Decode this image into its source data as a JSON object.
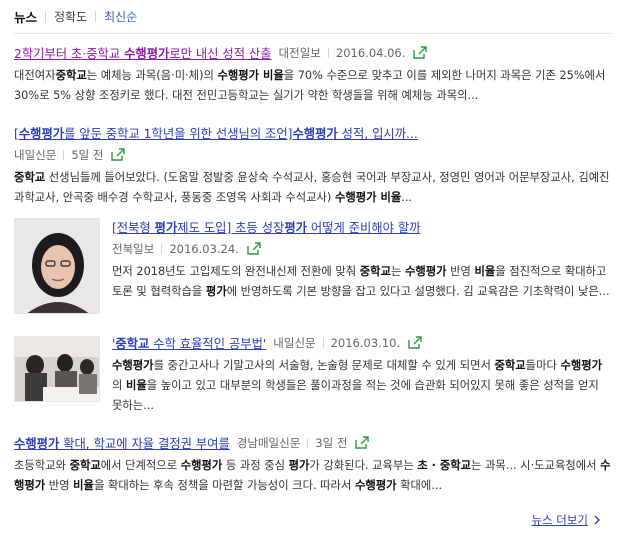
{
  "tabs": {
    "main": "뉴스",
    "sort1": "정확도",
    "sort2": "최신순"
  },
  "articles": [
    {
      "title_pre": "2학기부터 초·중학교 ",
      "title_bold": "수행평가",
      "title_post": "로만 내신 성적 산출",
      "source": "대전일보",
      "date": "2016.04.06.",
      "desc_parts": [
        [
          "대전여자",
          false
        ],
        [
          "중학교",
          true
        ],
        [
          "는 예체능 과목(음·미·체)의 ",
          false
        ],
        [
          "수행평가 비율",
          true
        ],
        [
          "을 70% 수준으로 맞추고 이를 제외한 나머지 과목은 기존 25%에서 30%로 5% 상향 조정키로 했다. 대전 전민고등학교는 실기가 약한 학생들을 위해 예체능 과목의...",
          false
        ]
      ]
    },
    {
      "title_pre": "[",
      "title_bold": "수행평가",
      "title_post": "를 앞둔 중학교 1학년을 위한 선생님의 조언]",
      "title_bold2": "수행평가",
      "title_post2": " 성적, 입시까...",
      "source": "내일신문",
      "date": "5일 전",
      "desc_parts": [
        [
          "중학교",
          true
        ],
        [
          " 선생님들께 들어보았다. (도움말 정발중 윤상숙 수석교사, 홍승현 국어과 부장교사, 정영민 영어과 어문부장교사, 김예진 과학교사, 안곡중 배수경 수학교사, 풍동중 조영옥 사회과 수석교사) ",
          false
        ],
        [
          "수행평가 비율",
          true
        ],
        [
          "...",
          false
        ]
      ]
    },
    {
      "title_pre": "[전북형 ",
      "title_bold": "평가",
      "title_post": "제도 도입] 초등 성장",
      "title_bold2": "평가",
      "title_post2": " 어떻게 준비해야 할까",
      "source": "전북일보",
      "date": "2016.03.24.",
      "desc_parts": [
        [
          "먼저 2018년도 고입제도의 완전내신제 전환에 맞춰 ",
          false
        ],
        [
          "중학교",
          true
        ],
        [
          "는 ",
          false
        ],
        [
          "수행평가",
          true
        ],
        [
          " 반영 ",
          false
        ],
        [
          "비율",
          true
        ],
        [
          "을 점진적으로 확대하고 토론 및 협력학습을 ",
          false
        ],
        [
          "평가",
          true
        ],
        [
          "에 반영하도록 기본 방향을 잡고 있다고 설명했다. 김 교육감은 기초학력이 낮은...",
          false
        ]
      ]
    },
    {
      "title_pre": "'",
      "title_bold": "중학교",
      "title_post": " 수학 효율적인 공부법'",
      "source": "내일신문",
      "date": "2016.03.10.",
      "desc_parts": [
        [
          "수행평가",
          true
        ],
        [
          "를 중간고사나 기말고사의 서술형, 논술형 문제로 대체할 수 있게 되면서 ",
          false
        ],
        [
          "중학교",
          true
        ],
        [
          "들마다 ",
          false
        ],
        [
          "수행평가",
          true
        ],
        [
          "의 ",
          false
        ],
        [
          "비율",
          true
        ],
        [
          "을 높이고 있고 대부분의 학생들은 풀이과정을 적는 것에 습관화 되어있지 못해 좋은 성적을 얻지 못하는...",
          false
        ]
      ]
    },
    {
      "title_pre": "",
      "title_bold": "수행평가",
      "title_post": " 확대, 학교에 자율 결정권 부여를",
      "source": "경남매일신문",
      "date": "3일 전",
      "desc_parts": [
        [
          "초등학교와 ",
          false
        ],
        [
          "중학교",
          true
        ],
        [
          "에서 단계적으로 ",
          false
        ],
        [
          "수행평가",
          true
        ],
        [
          " 등 과정 중심 ",
          false
        ],
        [
          "평가",
          true
        ],
        [
          "가 강화된다. 교육부는 ",
          false
        ],
        [
          "초 · 중학교",
          true
        ],
        [
          "는 과목... 시·도교육청에서 ",
          false
        ],
        [
          "수행평가",
          true
        ],
        [
          " 반영 ",
          false
        ],
        [
          "비율",
          true
        ],
        [
          "을 확대하는 후속 정책을 마련할 가능성이 크다. 따라서 ",
          false
        ],
        [
          "수행평가",
          true
        ],
        [
          " 확대에...",
          false
        ]
      ]
    }
  ],
  "more_label": "뉴스 더보기",
  "colors": {
    "link": "#2b3fb6",
    "visited": "#8a1ca8",
    "share_icon": "#2e9a3e"
  }
}
